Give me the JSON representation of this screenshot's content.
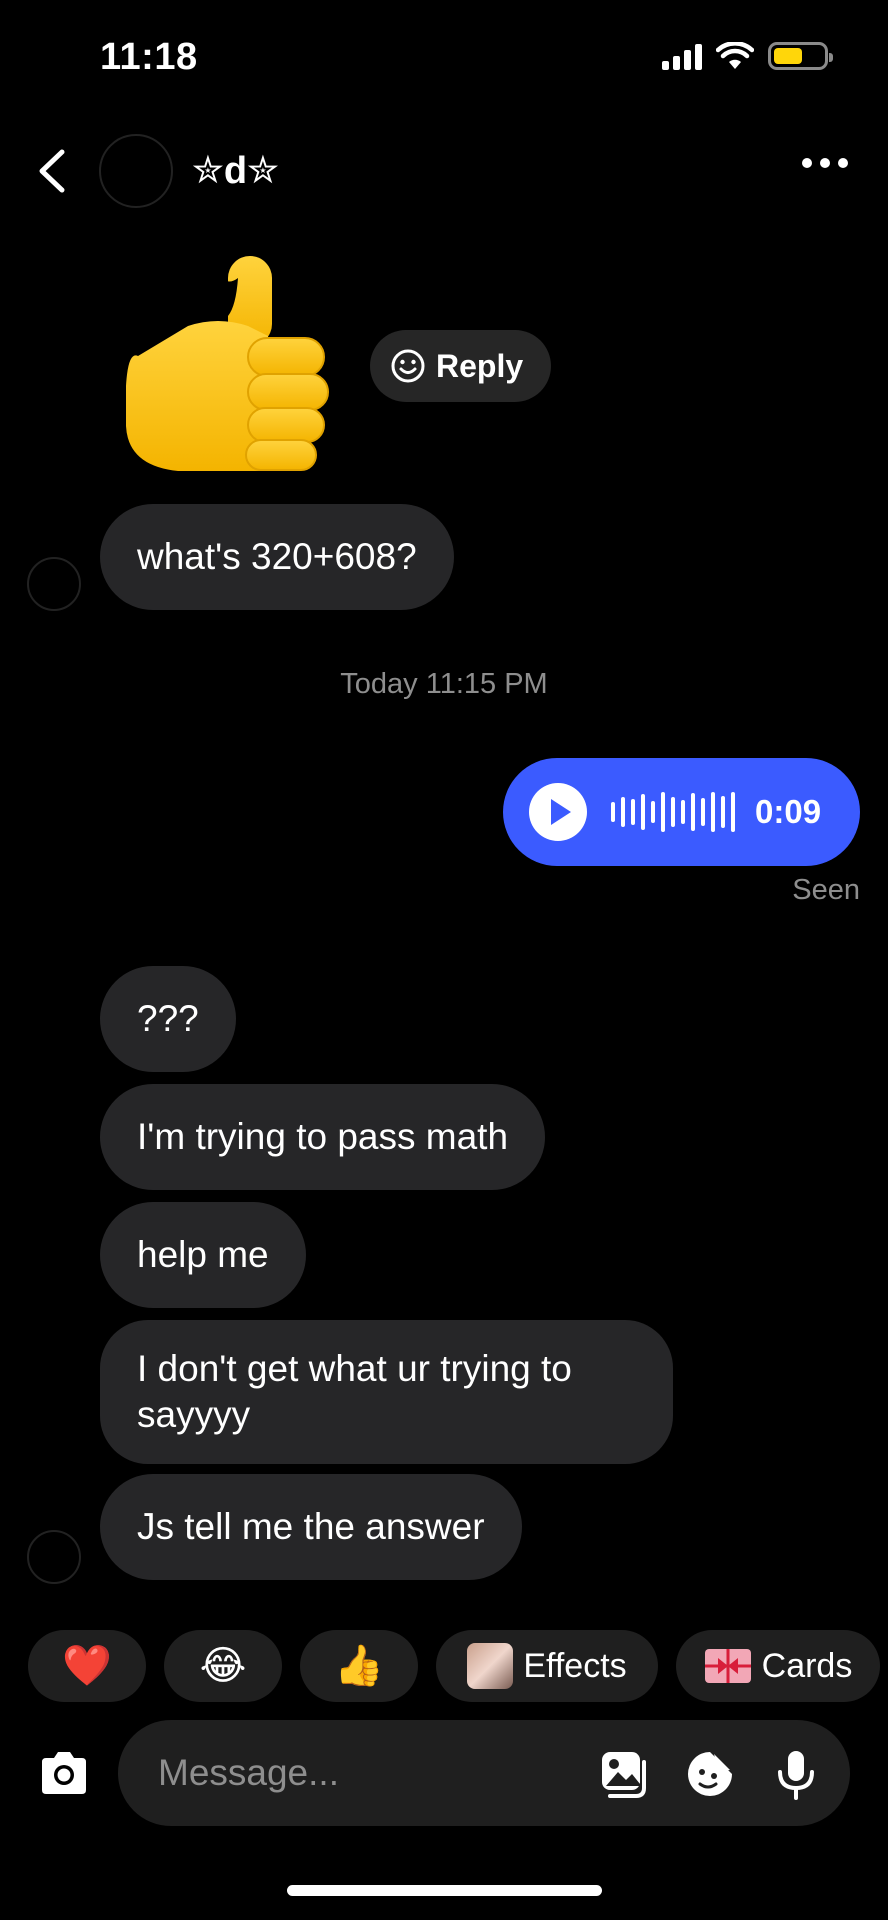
{
  "status_bar": {
    "time": "11:18",
    "battery_color": "#ffd60a"
  },
  "header": {
    "contact_name": "✮d✮",
    "back_icon": "chevron-left-icon",
    "more_icon": "ellipsis-icon"
  },
  "sticker": {
    "name": "thumbs-up-sticker",
    "reply_label": "Reply"
  },
  "messages": [
    {
      "side": "received",
      "text": "what's 320+608?"
    }
  ],
  "timestamp": "Today 11:15 PM",
  "voice_message": {
    "duration": "0:09",
    "status": "Seen",
    "color": "#3b5bff"
  },
  "messages_after": [
    {
      "text": "???"
    },
    {
      "text": "I'm trying to pass math"
    },
    {
      "text": "help me"
    },
    {
      "text": "I don't get what ur trying to sayyyy"
    },
    {
      "text": "Js tell me the answer"
    }
  ],
  "quick_reactions": [
    {
      "emoji": "❤️"
    },
    {
      "emoji": "😂"
    },
    {
      "emoji": "👍"
    },
    {
      "label": "Effects"
    },
    {
      "label": "Cards"
    }
  ],
  "composer": {
    "placeholder": "Message..."
  }
}
